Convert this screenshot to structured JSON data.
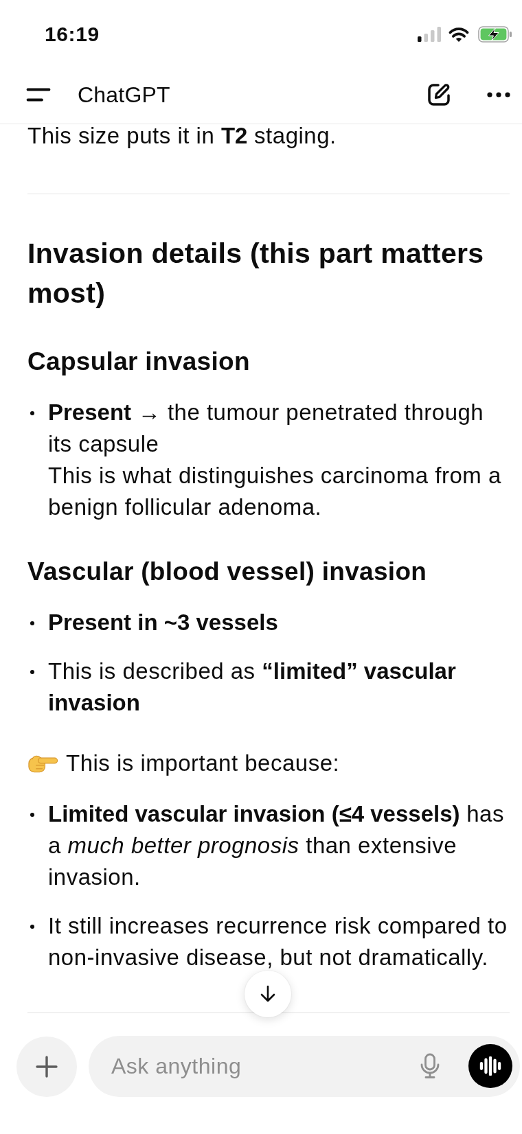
{
  "status_bar": {
    "time": "16:19"
  },
  "header": {
    "title": "ChatGPT"
  },
  "message": [
    {
      "kind": "paragraph",
      "text": "This size puts it in **T2** staging."
    },
    {
      "kind": "divider"
    },
    {
      "kind": "heading",
      "text": "Invasion details (this part matters most)"
    },
    {
      "kind": "subheading",
      "text": "Capsular invasion"
    },
    {
      "kind": "bullets",
      "items": [
        "**Present** → the tumour penetrated through its capsule\nThis is what distinguishes carcinoma from a benign follicular adenoma."
      ]
    },
    {
      "kind": "subheading",
      "text": "Vascular (blood vessel) invasion"
    },
    {
      "kind": "bullets",
      "items": [
        "**Present in ~3 vessels**",
        "This is described as **“limited” vascular invasion**"
      ]
    },
    {
      "kind": "callout",
      "text": "This is important because:"
    },
    {
      "kind": "bullets",
      "items": [
        "**Limited vascular invasion (≤4 vessels)** has a *much better prognosis* than extensive invasion.",
        "It still increases recurrence risk compared to non-invasive disease, but not dramatically."
      ]
    },
    {
      "kind": "divider"
    }
  ],
  "composer": {
    "placeholder": "Ask anything"
  }
}
